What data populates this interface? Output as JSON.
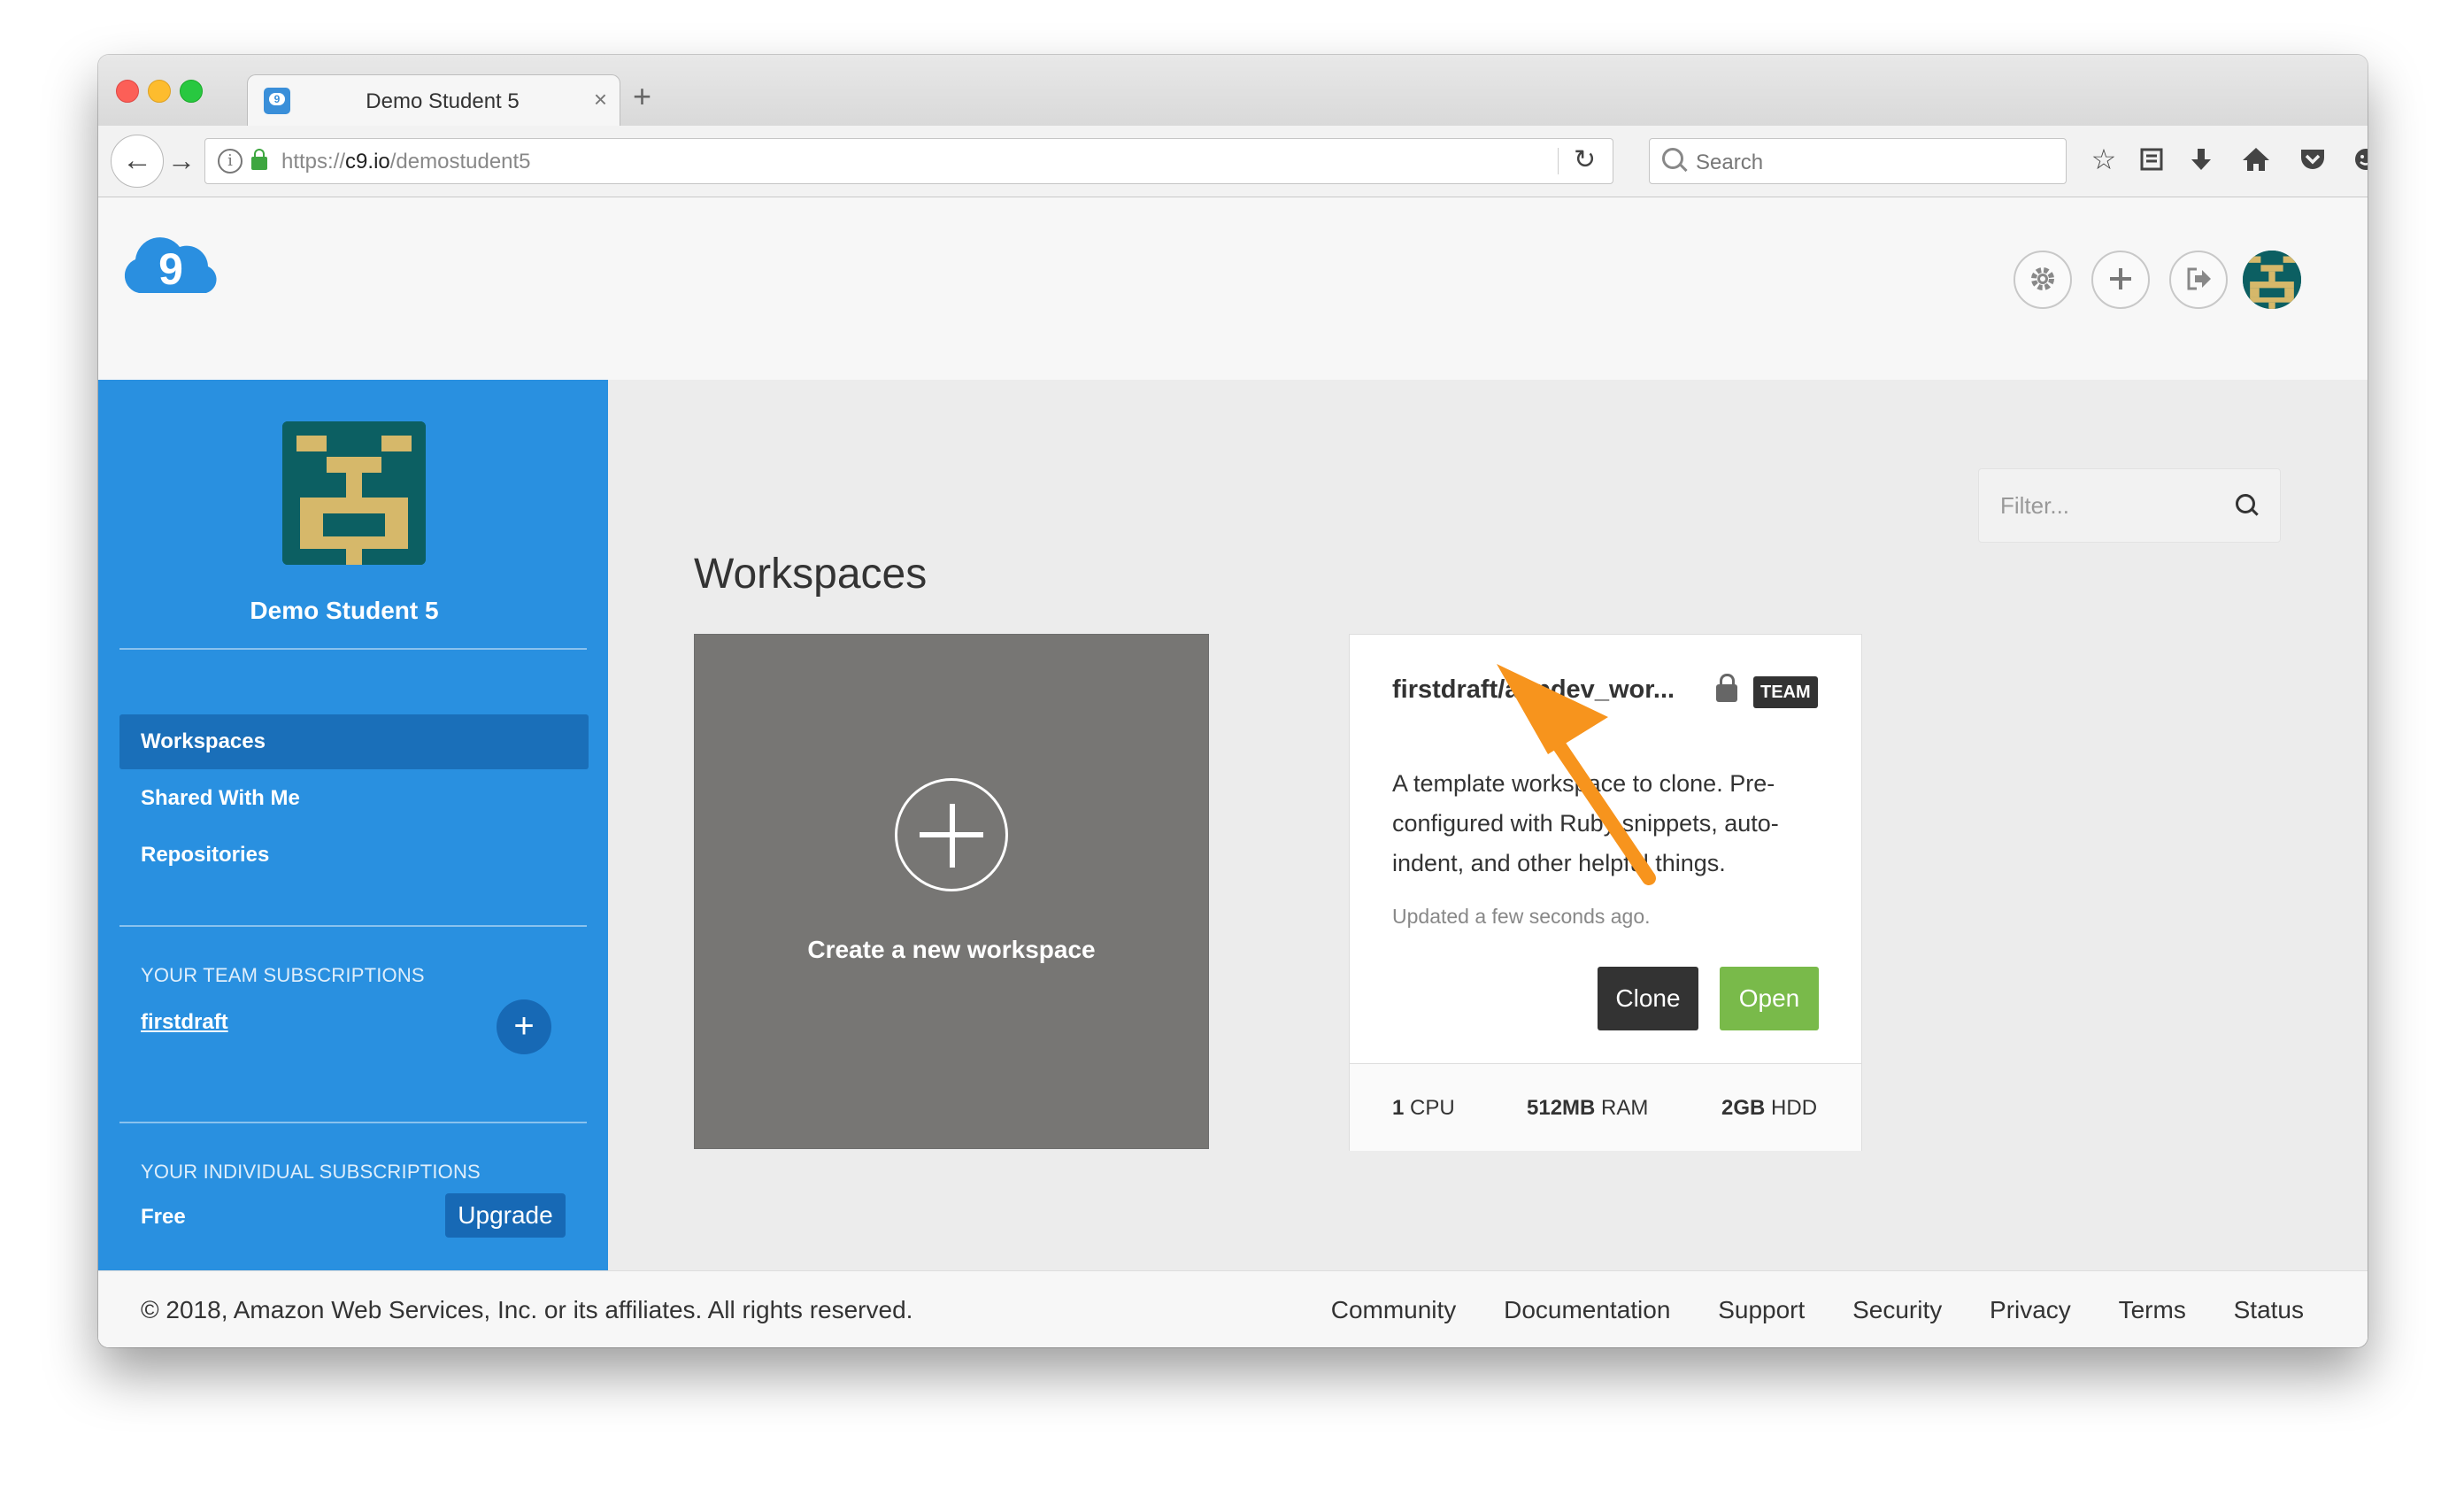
{
  "browser": {
    "tab_title": "Demo Student 5",
    "tab_close": "×",
    "new_tab": "+",
    "url_prefix": "https://",
    "url_host": "c9.io",
    "url_path": "/demostudent5",
    "search_placeholder": "Search",
    "icons": [
      "back-icon",
      "forward-icon",
      "info-icon",
      "lock-icon",
      "reload-icon",
      "search-icon",
      "bookmark-star-icon",
      "reading-list-icon",
      "download-icon",
      "home-icon",
      "pocket-icon",
      "smiley-icon",
      "hamburger-menu-icon"
    ]
  },
  "header": {
    "logo_text": "9",
    "buttons": [
      "settings-icon",
      "plus-icon",
      "logout-icon"
    ]
  },
  "sidebar": {
    "user_name": "Demo Student 5",
    "nav": [
      {
        "label": "Workspaces",
        "active": true
      },
      {
        "label": "Shared With Me",
        "active": false
      },
      {
        "label": "Repositories",
        "active": false
      }
    ],
    "team_section_title": "YOUR TEAM SUBSCRIPTIONS",
    "team_name": "firstdraft",
    "team_add": "+",
    "individual_section_title": "YOUR INDIVIDUAL SUBSCRIPTIONS",
    "plan": "Free",
    "upgrade_label": "Upgrade"
  },
  "main": {
    "filter_placeholder": "Filter...",
    "title": "Workspaces",
    "create_label": "Create a new workspace",
    "workspace": {
      "name": "firstdraft/appdev_wor...",
      "badge": "TEAM",
      "description": "A template workspace to clone. Pre-configured with Ruby snippets, auto-indent, and other helpful things.",
      "updated": "Updated a few seconds ago.",
      "clone_label": "Clone",
      "open_label": "Open",
      "cpu_value": "1",
      "cpu_unit": "CPU",
      "ram_value": "512MB",
      "ram_unit": "RAM",
      "hdd_value": "2GB",
      "hdd_unit": "HDD"
    }
  },
  "footer": {
    "copyright": "© 2018, Amazon Web Services, Inc. or its affiliates. All rights reserved.",
    "links": [
      "Community",
      "Documentation",
      "Support",
      "Security",
      "Privacy",
      "Terms",
      "Status"
    ]
  },
  "colors": {
    "sidebar_bg": "#2990e0",
    "sidebar_active": "#1a6fb9",
    "open_button": "#79ba4a",
    "clone_button": "#333333",
    "annotation_arrow": "#f7941d",
    "avatar_bg": "#0c5f62",
    "avatar_fg": "#d6b86a"
  }
}
